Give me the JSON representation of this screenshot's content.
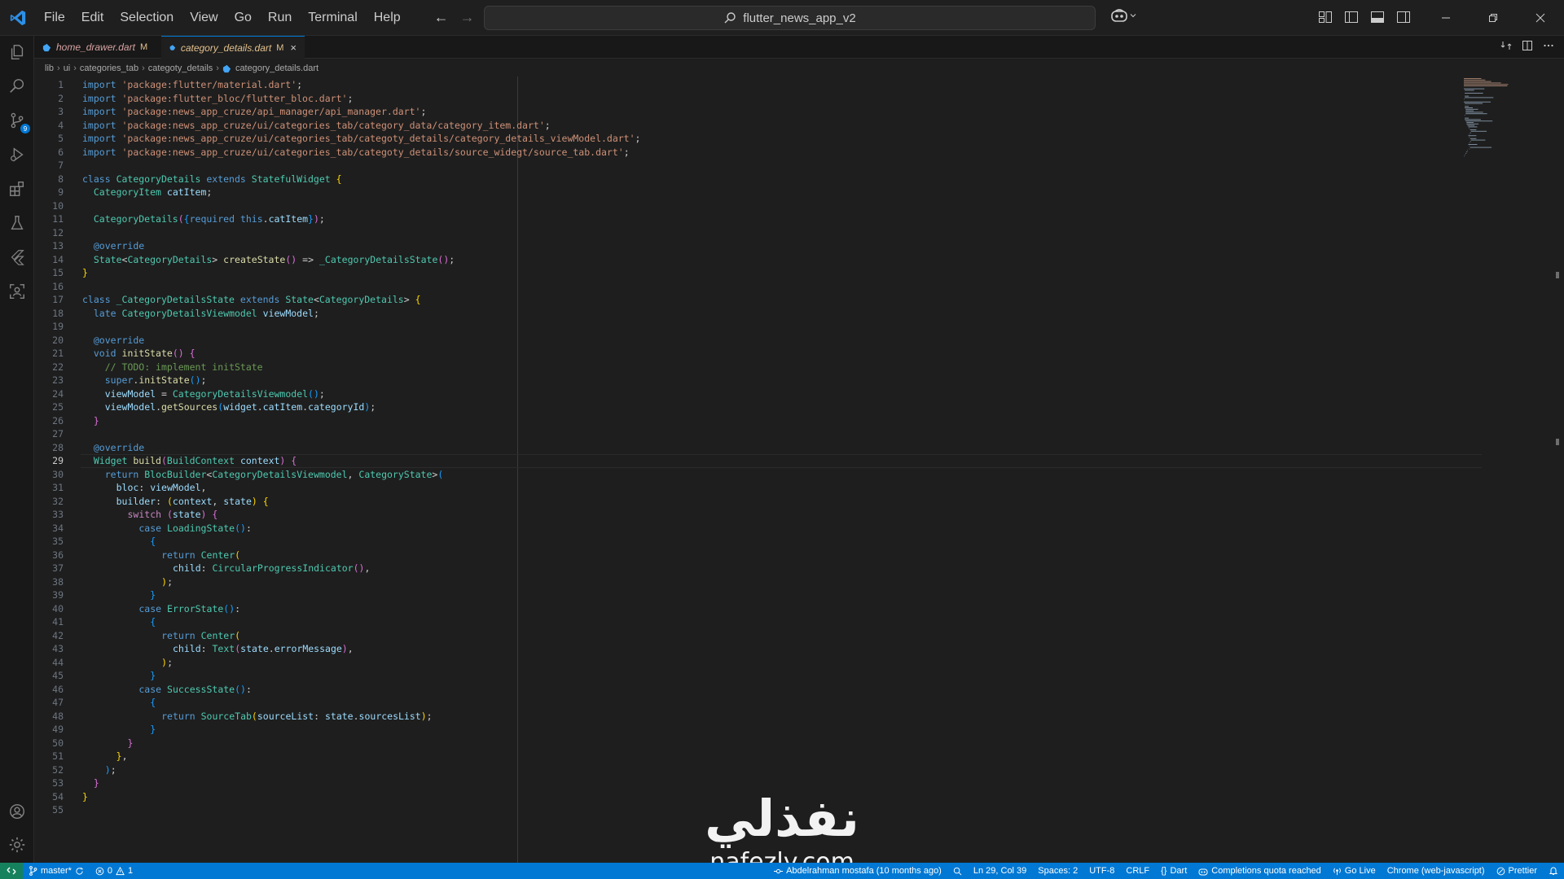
{
  "menu": [
    "File",
    "Edit",
    "Selection",
    "View",
    "Go",
    "Run",
    "Terminal",
    "Help"
  ],
  "search": {
    "text": "flutter_news_app_v2"
  },
  "tabs": [
    {
      "label": "home_drawer.dart",
      "status": "M"
    },
    {
      "label": "category_details.dart",
      "status": "M",
      "close": "×"
    }
  ],
  "breadcrumbs": [
    "lib",
    "ui",
    "categories_tab",
    "categoty_details",
    "category_details.dart"
  ],
  "code": {
    "current_line": 29,
    "lines": [
      "import 'package:flutter/material.dart';",
      "import 'package:flutter_bloc/flutter_bloc.dart';",
      "import 'package:news_app_cruze/api_manager/api_manager.dart';",
      "import 'package:news_app_cruze/ui/categories_tab/category_data/category_item.dart';",
      "import 'package:news_app_cruze/ui/categories_tab/categoty_details/category_details_viewModel.dart';",
      "import 'package:news_app_cruze/ui/categories_tab/categoty_details/source_widegt/source_tab.dart';",
      "",
      "class CategoryDetails extends StatefulWidget {",
      "  CategoryItem catItem;",
      "",
      "  CategoryDetails({required this.catItem});",
      "",
      "  @override",
      "  State<CategoryDetails> createState() => _CategoryDetailsState();",
      "}",
      "",
      "class _CategoryDetailsState extends State<CategoryDetails> {",
      "  late CategoryDetailsViewmodel viewModel;",
      "",
      "  @override",
      "  void initState() {",
      "    // TODO: implement initState",
      "    super.initState();",
      "    viewModel = CategoryDetailsViewmodel();",
      "    viewModel.getSources(widget.catItem.categoryId);",
      "  }",
      "",
      "  @override",
      "  Widget build(BuildContext context) {",
      "    return BlocBuilder<CategoryDetailsViewmodel, CategoryState>(",
      "      bloc: viewModel,",
      "      builder: (context, state) {",
      "        switch (state) {",
      "          case LoadingState():",
      "            {",
      "              return Center(",
      "                child: CircularProgressIndicator(),",
      "              );",
      "            }",
      "          case ErrorState():",
      "            {",
      "              return Center(",
      "                child: Text(state.errorMessage),",
      "              );",
      "            }",
      "          case SuccessState():",
      "            {",
      "              return SourceTab(sourceList: state.sourcesList);",
      "            }",
      "        }",
      "      },",
      "    );",
      "  }",
      "}",
      ""
    ]
  },
  "status": {
    "branch": "master*",
    "errors": "0",
    "warnings": "1",
    "blame": "Abdelrahman mostafa (10 months ago)",
    "cursor": "Ln 29, Col 39",
    "spaces": "Spaces: 2",
    "encoding": "UTF-8",
    "eol": "CRLF",
    "language": "Dart",
    "completions": "Completions quota reached",
    "go_live": "Go Live",
    "device": "Chrome (web-javascript)",
    "prettier": "Prettier"
  },
  "watermark": {
    "arabic": "نفذلي",
    "latin": "nafezly.com"
  },
  "colors": {
    "accent": "#0078d4",
    "status_bar": "#0078d4",
    "remote": "#16825d",
    "modified": "#e2c08d"
  }
}
